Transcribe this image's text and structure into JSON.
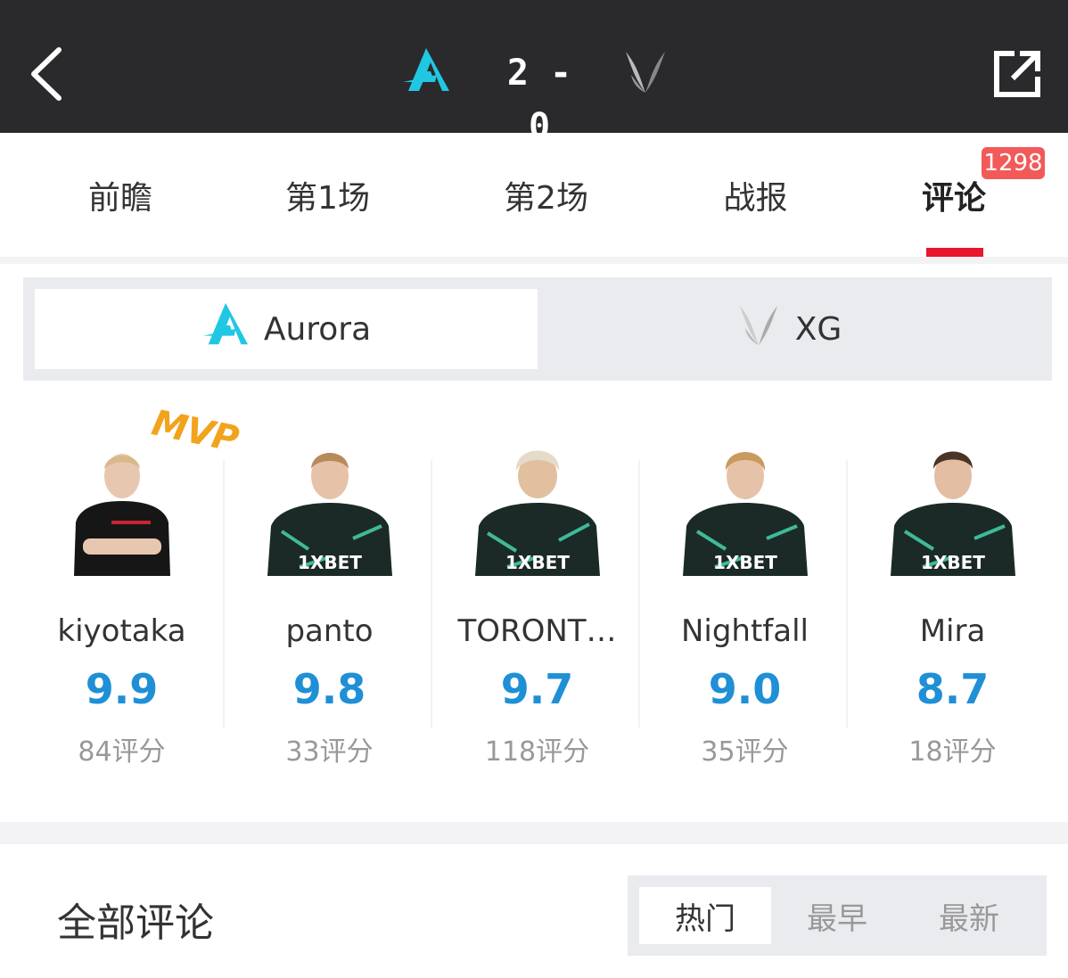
{
  "header": {
    "score": "2 - 0",
    "team_left_icon": "aurora-logo-icon",
    "team_right_icon": "xg-logo-icon",
    "accent": "#20c7e3"
  },
  "tabs": [
    {
      "label": "前瞻"
    },
    {
      "label": "第1场"
    },
    {
      "label": "第2场"
    },
    {
      "label": "战报"
    },
    {
      "label": "评论",
      "active": true,
      "badge": "1298"
    }
  ],
  "team_switch": {
    "options": [
      {
        "label": "Aurora",
        "selected": true
      },
      {
        "label": "XG",
        "selected": false
      }
    ]
  },
  "players": [
    {
      "name": "kiyotaka",
      "rating": "9.9",
      "count": "84评分",
      "mvp": "MVP"
    },
    {
      "name": "panto",
      "rating": "9.8",
      "count": "33评分"
    },
    {
      "name": "TORONT…",
      "rating": "9.7",
      "count": "118评分"
    },
    {
      "name": "Nightfall",
      "rating": "9.0",
      "count": "35评分"
    },
    {
      "name": "Mira",
      "rating": "8.7",
      "count": "18评分"
    }
  ],
  "comments": {
    "title": "全部评论",
    "sort": [
      {
        "label": "热门",
        "selected": true
      },
      {
        "label": "最早",
        "selected": false
      },
      {
        "label": "最新",
        "selected": false
      }
    ]
  }
}
